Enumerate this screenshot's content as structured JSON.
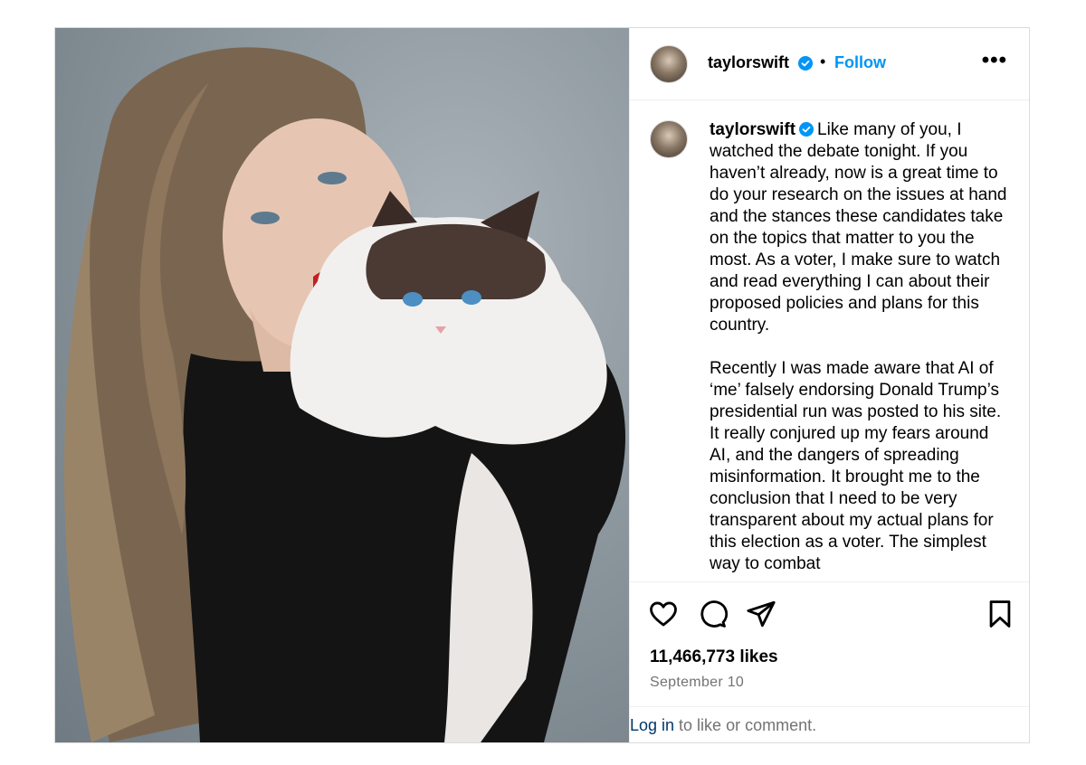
{
  "post": {
    "username": "taylorswift",
    "follow_label": "Follow",
    "separator": "•",
    "more_label": "•••",
    "caption_intro": "Like many of you, I watched the debate tonight. If you haven’t already, now is a great time to do your research on the issues at hand and the stances these candidates take on the topics that matter to you the most. As a voter, I make sure to watch and read everything I can about their proposed policies and plans for this country.",
    "caption_p2": "Recently I was made aware that AI of ‘me’ falsely endorsing Donald Trump’s presidential run was posted to his site. It really conjured up my fears around AI, and the dangers of spreading misinformation. It brought me to the conclusion that I need to be very transparent about my actual plans for this election as a voter. The simplest way to combat",
    "likes": "11,466,773 likes",
    "date": "September 10",
    "login_link": "Log in",
    "login_rest": " to like or comment."
  },
  "colors": {
    "accent": "#0095f6",
    "verified": "#0095f6",
    "muted": "#737373",
    "link": "#00376b"
  },
  "icons": [
    "verified-badge-icon",
    "more-icon",
    "heart-icon",
    "comment-icon",
    "share-icon",
    "bookmark-icon"
  ]
}
